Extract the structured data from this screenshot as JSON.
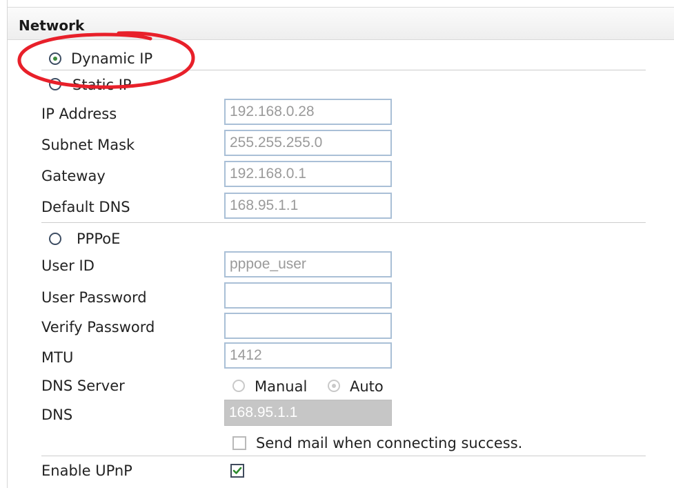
{
  "header": {
    "title": "Network"
  },
  "connection": {
    "dynamic_ip_label": "Dynamic IP",
    "static_ip_label": "Static IP",
    "pppoe_label": "PPPoE",
    "selected": "Dynamic IP"
  },
  "static_ip": {
    "ip_address": {
      "label": "IP Address",
      "value": "192.168.0.28"
    },
    "subnet_mask": {
      "label": "Subnet Mask",
      "value": "255.255.255.0"
    },
    "gateway": {
      "label": "Gateway",
      "value": "192.168.0.1"
    },
    "default_dns": {
      "label": "Default DNS",
      "value": "168.95.1.1"
    }
  },
  "pppoe": {
    "user_id": {
      "label": "User ID",
      "value": "pppoe_user"
    },
    "user_password": {
      "label": "User Password",
      "value": ""
    },
    "verify_password": {
      "label": "Verify Password",
      "value": ""
    },
    "mtu": {
      "label": "MTU",
      "value": "1412"
    },
    "dns_server": {
      "label": "DNS Server",
      "manual_label": "Manual",
      "auto_label": "Auto",
      "selected": "Auto"
    },
    "dns": {
      "label": "DNS",
      "value": "168.95.1.1"
    },
    "send_mail_label": "Send mail when connecting success.",
    "send_mail_checked": false
  },
  "upnp": {
    "label": "Enable UPnP",
    "checked": true
  },
  "colors": {
    "annotation_ring": "#e8202a",
    "radio_dot": "#3b8a3b",
    "field_border": "#a9bfd6",
    "disabled_field": "#c6c6c6"
  }
}
